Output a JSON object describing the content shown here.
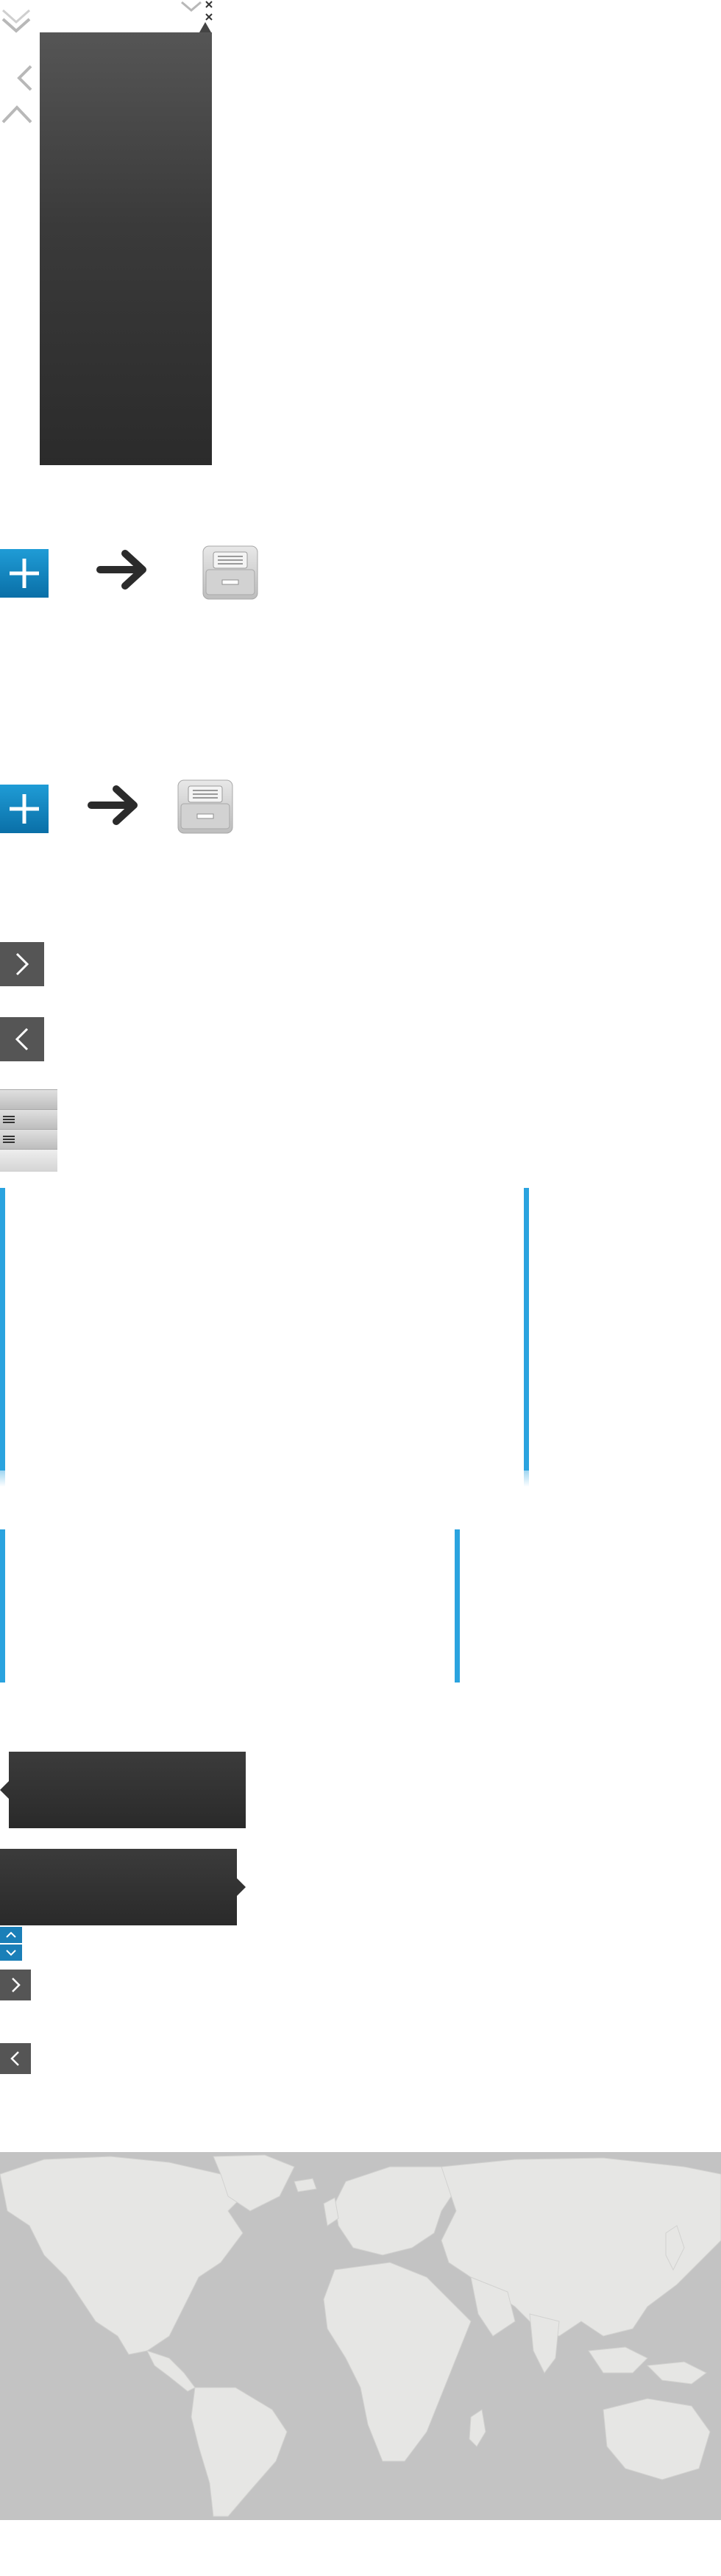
{
  "sprites": {
    "top_chevrons": [
      "chevron-down-icon",
      "chevron-left-icon",
      "chevron-up-icon"
    ],
    "close_icons": [
      "close-icon",
      "close-icon"
    ]
  },
  "actions_row_1": [
    "plus-icon",
    "arrow-right-icon",
    "archive-cabinet-icon"
  ],
  "actions_row_2": [
    "plus-icon",
    "arrow-right-icon",
    "archive-cabinet-icon"
  ],
  "nav_buttons": [
    "chevron-right-icon",
    "chevron-left-icon"
  ],
  "list_strip_icons": [
    "list-icon",
    "list-icon"
  ],
  "small_nav_buttons": [
    "chevron-up-icon",
    "chevron-down-icon",
    "chevron-right-icon",
    "chevron-left-icon"
  ],
  "colors": {
    "accent_blue": "#2aa3df",
    "dark_panel": "#2b2b2b",
    "nav_gray": "#555555",
    "map_ocean": "#c3c3c3",
    "map_land": "#e6e6e4"
  },
  "map": {
    "icon": "world-map"
  }
}
